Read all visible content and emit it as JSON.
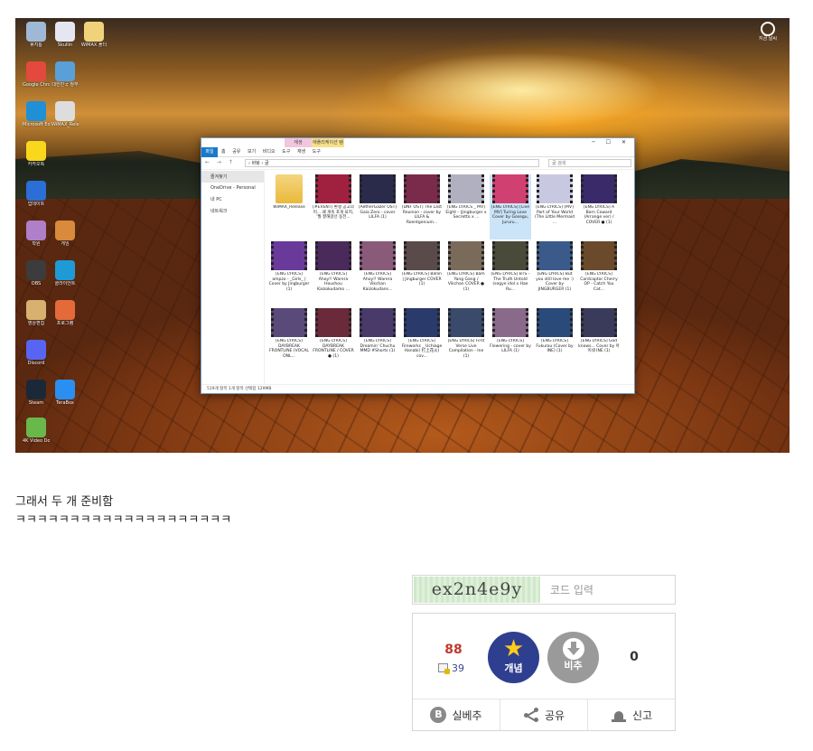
{
  "screenshot": {
    "desktop_icons": [
      {
        "label": "휴지통",
        "color": "#9fb8d6"
      },
      {
        "label": "Skullin",
        "color": "#e6e6f2"
      },
      {
        "label": "WiMAX 폴더",
        "color": "#efd27a"
      },
      {
        "label": "Google Chrome",
        "color": "#e3493c"
      },
      {
        "label": "대한민국 정부",
        "color": "#5aa0d8"
      },
      {
        "label": "Microsoft Edge",
        "color": "#1f8fd6"
      },
      {
        "label": "WiMAX_Release",
        "color": "#dddddd"
      },
      {
        "label": "카카오톡",
        "color": "#f9d71c"
      },
      {
        "label": "업데이트",
        "color": "#2b6fd6"
      },
      {
        "label": "학원",
        "color": "#b07fc9"
      },
      {
        "label": "게임",
        "color": "#d98a3a"
      },
      {
        "label": "OBS",
        "color": "#3c3c3c"
      },
      {
        "label": "클라이언트",
        "color": "#1f9ad6"
      },
      {
        "label": "영상편집",
        "color": "#d8b070"
      },
      {
        "label": "프로그램",
        "color": "#e46a3a"
      },
      {
        "label": "Discord",
        "color": "#5865f2"
      },
      {
        "label": "Steam",
        "color": "#1b2838"
      },
      {
        "label": "TeraBox",
        "color": "#2a8ff0"
      },
      {
        "label": "4K Video Downloader",
        "color": "#69b84a"
      }
    ],
    "clock_widget_label": "지금 날씨",
    "explorer": {
      "ctx_tab_1": "재생",
      "ctx_tab_2": "애플리케이션 템플",
      "file_tab": "파일",
      "ribbon_tabs": "홈 공유 보기 비디오 도구 재생 도구",
      "path": "› 바탕 › 굴",
      "search_placeholder": "굴 검색",
      "sidebar": [
        "즐겨찾기",
        "OneDrive - Personal",
        "내 PC",
        "네트워크"
      ],
      "files": [
        "WiMAX_Release",
        "[#EVENT] 환쟁 공고의미... 왜 게속 포게 되지, '월 잘해갈선 동전...",
        "[AetherGazer OST] Gaia Zero - cover LILFA (1)",
        "[DNF OST] The Last Reunion - cover by LILFA & Roentgenium...",
        "[ENG LYRICS _ MV] Eight - (Jingburger x Secretto x ...",
        "[ENG LYRICS] [Live MV] Turing Love Cover by Gosegu, Jururu...",
        "[ENG LYRICS] [MV] Part of Your World (The Little Mermaid ...",
        "[ENG LYRICS] A Born Coward (Arrange ver) / COVER ● (1)",
        "[ENG LYRICS] ampzo - _Girls_ | Cover by Jingburger (1)",
        "[ENG LYRICS] Ahoy!! Warera Houshou Kaizokudamo ...",
        "[ENG LYRICS] Ahoy!! Warera Vikchan Kaizokudans...",
        "[ENG LYRICS] Ballin | Jingburger COVER (1)",
        "[ENG LYRICS] Bam Yang Gang / Vikchan COVER ● (1)",
        "[ENG LYRICS] BTS - The Truth Untold (segye idol x Hae Ru...",
        "[ENG LYRICS] But you still love me :) Cover by JINGBURGER (1)",
        "[ENG LYRICS] Cardcaptor Cherry OP - Catch You Cat...",
        "[ENG LYRICS] DAYBREAK FRONTLINE (VOCAL ONL...",
        "[ENG LYRICS] DAYBREAK FRONTLINE / COVER ● (1)",
        "[ENG LYRICS] Dreamin' Chuchu MMD #Shorts (1)",
        "[ENG LYRICS] Fireworks _ Uchiage Hanabi( 打上花火) cov...",
        "[ENG LYRICS] First Verse Live Compilation - Ine (1)",
        "[ENG LYRICS] Flowering - cover by LILFA (1)",
        "[ENG LYRICS] Fukurou (Cover by INE) (1)",
        "[ENG LYRICS] God knows... Cover by 아이네 INE (1)"
      ],
      "thumb_colors": [
        "#5b3b8a",
        "#a02040",
        "#2a2a4a",
        "#7a2a4a",
        "#b0b0c0",
        "#d04070",
        "#c8c8e0",
        "#3a2a6a",
        "#6a3a9a",
        "#4a2a5a",
        "#8a5a7a",
        "#5a4a4a",
        "#7a6a5a",
        "#4a4a3a",
        "#3a5a8a",
        "#6a4a2a",
        "#5a4a7a",
        "#6a2a3a",
        "#4a3a6a",
        "#2a3a6a",
        "#3a4a6a",
        "#8a6a8a",
        "#2a4a7a",
        "#3a3a5a"
      ],
      "status": "519개 항목 1개 항목 선택함 129MB"
    }
  },
  "post": {
    "line1": "그래서 두 개 준비함",
    "line2": "ㅋㅋㅋㅋㅋㅋㅋㅋㅋㅋㅋㅋㅋㅋㅋㅋㅋㅋㅋㅋ"
  },
  "captcha": {
    "code": "ex2n4e9y",
    "placeholder": "코드 입력"
  },
  "vote": {
    "up_count": "88",
    "fixed_count": "39",
    "up_label": "개념",
    "down_label": "비추",
    "down_count": "0",
    "actions": {
      "report_bad": "실베추",
      "share": "공유",
      "report": "신고"
    }
  }
}
